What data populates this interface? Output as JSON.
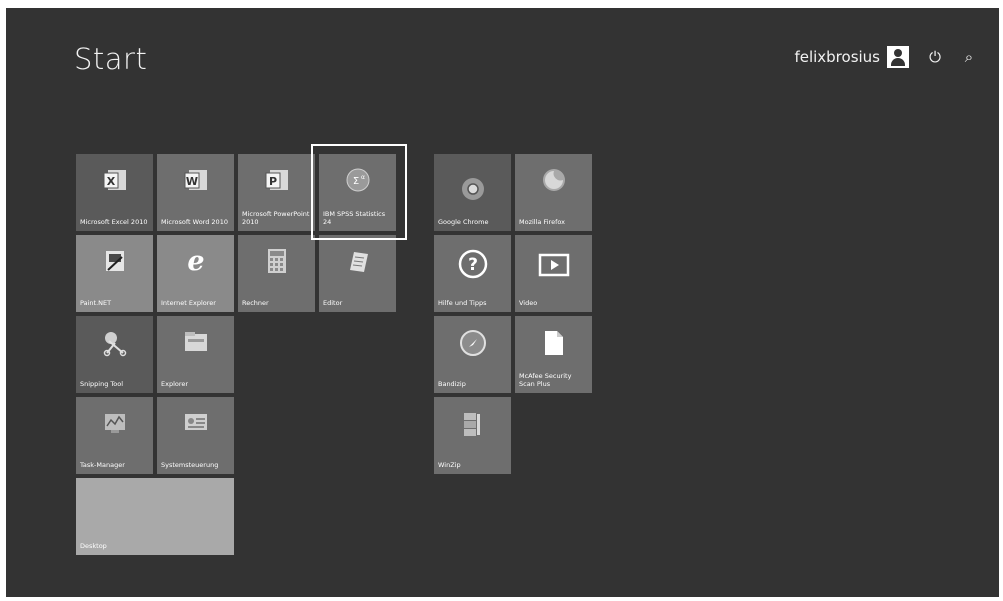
{
  "title": "Start",
  "user": {
    "name": "felixbrosius"
  },
  "icons": {
    "avatar": "user-avatar-icon",
    "power": "power-icon",
    "search": "search-icon"
  },
  "glyphs": {
    "power": "⏻",
    "search": "⌕"
  },
  "tiles": {
    "excel": {
      "label": "Microsoft Excel 2010",
      "icon": "excel-icon"
    },
    "word": {
      "label": "Microsoft Word 2010",
      "icon": "word-icon"
    },
    "powerpoint": {
      "label": "Microsoft PowerPoint 2010",
      "icon": "powerpoint-icon"
    },
    "spss": {
      "label": "IBM SPSS Statistics 24",
      "icon": "spss-icon"
    },
    "paint": {
      "label": "Paint.NET",
      "icon": "paint-icon"
    },
    "ie": {
      "label": "Internet Explorer",
      "icon": "ie-icon"
    },
    "calculator": {
      "label": "Rechner",
      "icon": "calculator-icon"
    },
    "editor": {
      "label": "Editor",
      "icon": "editor-icon"
    },
    "snipping": {
      "label": "Snipping Tool",
      "icon": "snipping-icon"
    },
    "explorer": {
      "label": "Explorer",
      "icon": "explorer-icon"
    },
    "taskmanager": {
      "label": "Task-Manager",
      "icon": "task-manager-icon"
    },
    "controlpanel": {
      "label": "Systemsteuerung",
      "icon": "control-panel-icon"
    },
    "desktop": {
      "label": "Desktop"
    },
    "chrome": {
      "label": "Google Chrome",
      "icon": "chrome-icon"
    },
    "firefox": {
      "label": "Mozilla Firefox",
      "icon": "firefox-icon"
    },
    "help": {
      "label": "Hilfe und Tipps",
      "icon": "help-icon"
    },
    "video": {
      "label": "Video",
      "icon": "video-icon"
    },
    "bandizip": {
      "label": "Bandizip",
      "icon": "bandizip-icon"
    },
    "mcafee": {
      "label": "McAfee Security Scan Plus",
      "icon": "mcafee-icon"
    },
    "winzip": {
      "label": "WinZip",
      "icon": "winzip-icon"
    }
  }
}
